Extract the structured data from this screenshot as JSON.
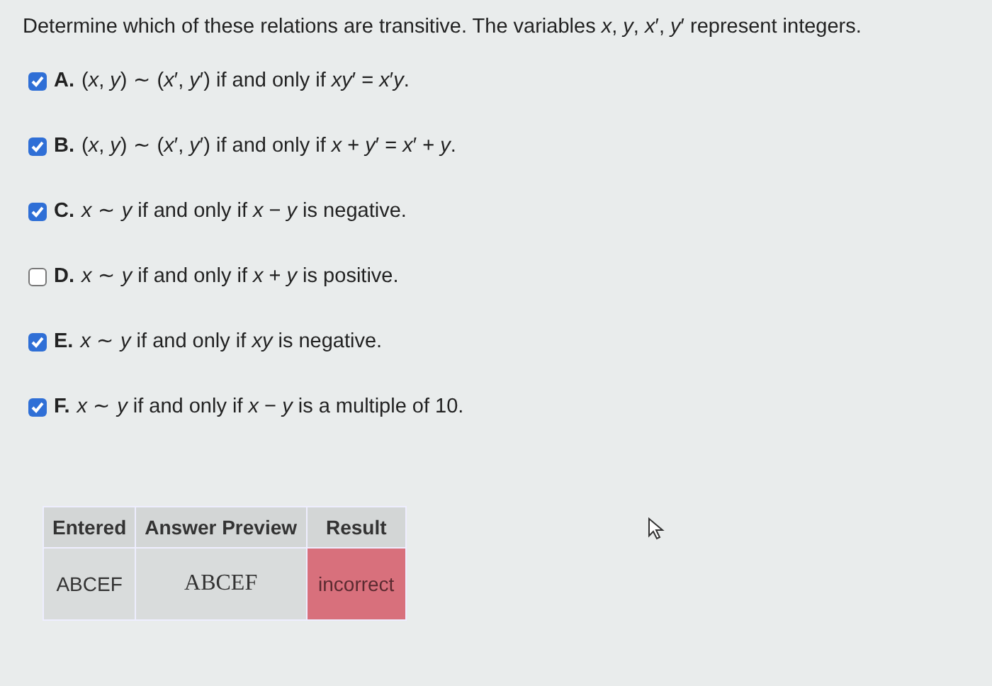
{
  "question": "Determine which of these relations are transitive. The variables *x*, *y*, *x*′, *y*′ represent integers.",
  "options": [
    {
      "label": "A.",
      "text": "(*x*, *y*) ∼ (*x*′, *y*′) if and only if *xy*′ = *x*′*y*.",
      "checked": true
    },
    {
      "label": "B.",
      "text": "(*x*, *y*) ∼ (*x*′, *y*′) if and only if *x* + *y*′ = *x*′ + *y*.",
      "checked": true
    },
    {
      "label": "C.",
      "text": "*x* ∼ *y* if and only if *x* − *y* is negative.",
      "checked": true
    },
    {
      "label": "D.",
      "text": "*x* ∼ *y* if and only if *x* + *y* is positive.",
      "checked": false
    },
    {
      "label": "E.",
      "text": "*x* ∼ *y* if and only if *xy* is negative.",
      "checked": true
    },
    {
      "label": "F.",
      "text": "*x* ∼ *y* if and only if *x* − *y* is a multiple of 10.",
      "checked": true
    }
  ],
  "results_table": {
    "columns": [
      "Entered",
      "Answer Preview",
      "Result"
    ],
    "rows": [
      {
        "entered": "ABCEF",
        "answer_preview": "ABCEF",
        "result": "incorrect",
        "correct": false
      }
    ]
  }
}
